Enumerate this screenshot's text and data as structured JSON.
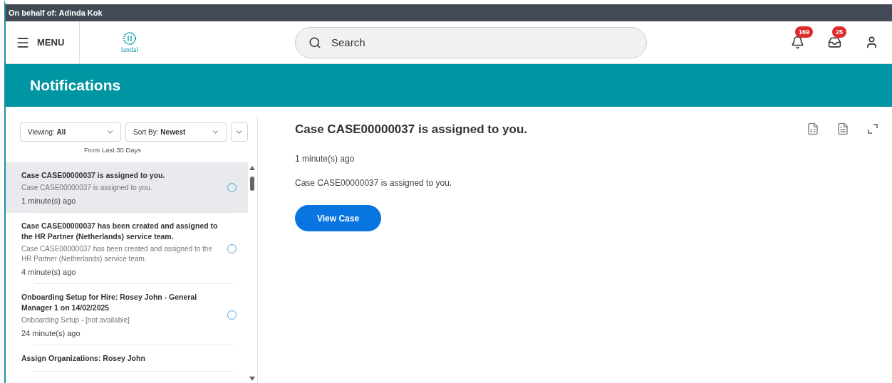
{
  "top_bar": {
    "text": "On behalf of: Adinda Kok"
  },
  "header": {
    "menu_label": "MENU",
    "logo_text": "landal",
    "search": {
      "placeholder": "Search"
    },
    "notifications_badge": "169",
    "inbox_badge": "25"
  },
  "banner": {
    "title": "Notifications"
  },
  "filters": {
    "viewing": {
      "label": "Viewing:",
      "value": "All"
    },
    "sort": {
      "label": "Sort By:",
      "value": "Newest"
    },
    "range": "From Last 30 Days"
  },
  "items": [
    {
      "title": "Case CASE00000037 is assigned to you.",
      "description": "Case CASE00000037 is assigned to you.",
      "time": "1 minute(s) ago",
      "selected": true,
      "unread": true
    },
    {
      "title": "Case CASE00000037 has been created and assigned to the HR Partner (Netherlands) service team.",
      "description": "Case CASE00000037 has been created and assigned to the HR Partner (Netherlands) service team.",
      "time": "4 minute(s) ago",
      "selected": false,
      "unread": true
    },
    {
      "title": "Onboarding Setup for Hire: Rosey John - General Manager 1 on 14/02/2025",
      "description": "Onboarding Setup - [not available]",
      "time": "24 minute(s) ago",
      "selected": false,
      "unread": true
    },
    {
      "title": "Assign Organizations: Rosey John",
      "selected": false,
      "unread": false
    }
  ],
  "detail": {
    "title": "Case CASE00000037 is assigned to you.",
    "time": "1 minute(s) ago",
    "body": "Case CASE00000037 is assigned to you.",
    "button": "View Case"
  }
}
